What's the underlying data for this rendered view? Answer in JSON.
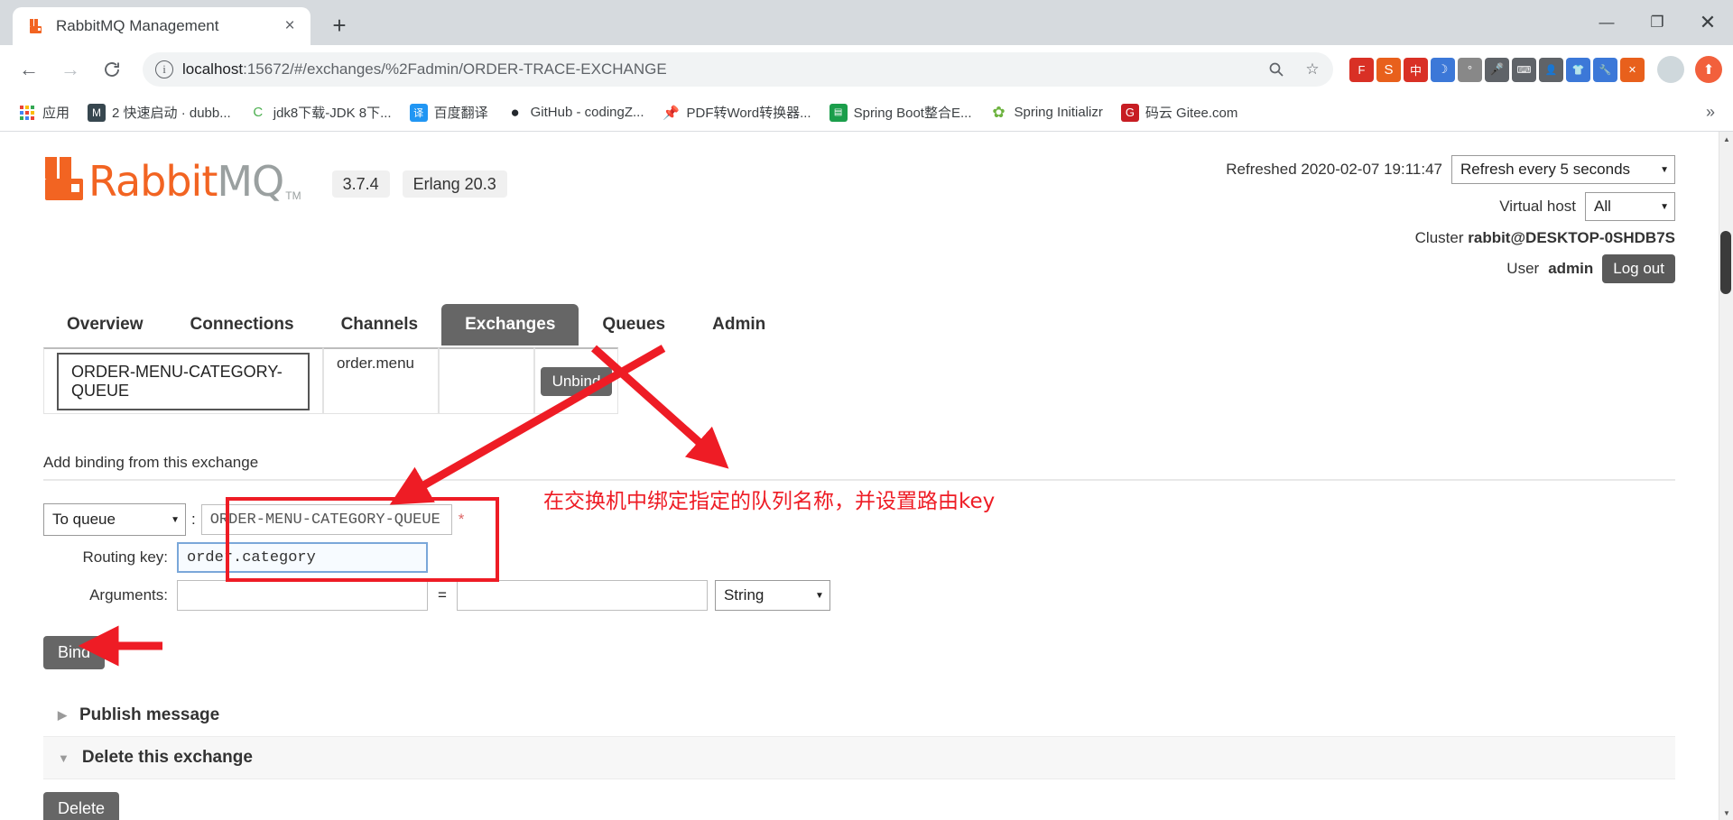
{
  "browser": {
    "tab": {
      "title": "RabbitMQ Management",
      "favicon": "rabbitmq-icon",
      "close": "×"
    },
    "newtab_label": "+",
    "window_controls": {
      "minimize": "—",
      "maximize": "❐",
      "close": "✕"
    },
    "nav": {
      "back": "←",
      "forward": "→",
      "reload": "C"
    },
    "omnibox": {
      "info_icon": "ⓘ",
      "url_host": "localhost",
      "url_path": ":15672/#/exchanges/%2Fadmin/ORDER-TRACE-EXCHANGE",
      "url_full": "localhost:15672/#/exchanges/%2Fadmin/ORDER-TRACE-EXCHANGE",
      "zoom_icon": "zoom-icon",
      "star_icon": "☆"
    },
    "extensions": [
      {
        "name": "translate-ext-icon",
        "glyph": "F",
        "color": "#d93025"
      },
      {
        "name": "sogou-ime-icon",
        "glyph": "S",
        "color": "#e8601c"
      },
      {
        "name": "ime-chinese-icon",
        "glyph": "中",
        "color": "#d93025"
      },
      {
        "name": "ime-moon-icon",
        "glyph": "☽",
        "color": "#3c78d8"
      },
      {
        "name": "ime-emoji-icon",
        "glyph": "°",
        "color": "#5f6368"
      },
      {
        "name": "ime-mic-icon",
        "glyph": "🎤",
        "color": "#5f6368"
      },
      {
        "name": "ime-keyboard-icon",
        "glyph": "⌨",
        "color": "#5f6368"
      },
      {
        "name": "ime-person-icon",
        "glyph": "👤",
        "color": "#5f6368"
      },
      {
        "name": "ime-shirt-icon",
        "glyph": "👕",
        "color": "#3c78d8"
      },
      {
        "name": "ime-wrench-icon",
        "glyph": "🔧",
        "color": "#3c78d8"
      },
      {
        "name": "ime-close-icon",
        "glyph": "✕",
        "color": "#e8601c"
      }
    ],
    "avatar": "profile-avatar",
    "menu": "chrome-menu-icon",
    "bookmarks": [
      {
        "label": "应用",
        "icon": "apps-grid-icon",
        "color": "#ffffff"
      },
      {
        "label": "2 快速启动 · dubb...",
        "icon": "notebook-icon",
        "color": "#37474f"
      },
      {
        "label": "jdk8下载-JDK 8下...",
        "icon": "csdn-icon",
        "color": "#4caf50"
      },
      {
        "label": "百度翻译",
        "icon": "translate-icon",
        "color": "#2196f3"
      },
      {
        "label": "GitHub - codingZ...",
        "icon": "github-icon",
        "color": "#24292e"
      },
      {
        "label": "PDF转Word转换器...",
        "icon": "pdf-icon",
        "color": "#e8601c"
      },
      {
        "label": "Spring Boot整合E...",
        "icon": "spring-doc-icon",
        "color": "#1b9e4b"
      },
      {
        "label": "Spring Initializr",
        "icon": "spring-icon",
        "color": "#6db33f"
      },
      {
        "label": "码云 Gitee.com",
        "icon": "gitee-icon",
        "color": "#c71d23"
      }
    ],
    "bookmarks_overflow": "»"
  },
  "app": {
    "logo": {
      "text_a": "Rabbit",
      "text_b": "MQ",
      "tm": "TM",
      "mark": "rabbitmq-logo-mark"
    },
    "version_badge": "3.7.4",
    "erlang_badge": "Erlang 20.3",
    "header": {
      "refreshed_text": "Refreshed 2020-02-07 19:11:47",
      "refresh_select": {
        "value": "Refresh every 5 seconds",
        "arrow": "▼"
      },
      "vhost_label": "Virtual host",
      "vhost_select": {
        "value": "All",
        "arrow": "▼"
      },
      "cluster_label": "Cluster",
      "cluster_value": "rabbit@DESKTOP-0SHDB7S",
      "user_label": "User",
      "user_value": "admin",
      "logout_label": "Log out"
    },
    "tabs": [
      {
        "label": "Overview",
        "active": false
      },
      {
        "label": "Connections",
        "active": false
      },
      {
        "label": "Channels",
        "active": false
      },
      {
        "label": "Exchanges",
        "active": true
      },
      {
        "label": "Queues",
        "active": false
      },
      {
        "label": "Admin",
        "active": false
      }
    ],
    "bindings_row": {
      "queue_name": "ORDER-MENU-CATEGORY-QUEUE",
      "routing_key": "order.menu",
      "arguments": "",
      "unbind_label": "Unbind"
    },
    "add_binding": {
      "section_title": "Add binding from this exchange",
      "target_select": {
        "value": "To queue",
        "arrow": "▼"
      },
      "colon": ":",
      "destination_value": "ORDER-MENU-CATEGORY-QUEUE",
      "destination_required_mark": "*",
      "routing_key_label": "Routing key:",
      "routing_key_value": "order.category",
      "arguments_label": "Arguments:",
      "argument_key_value": "",
      "equals": "=",
      "argument_value_value": "",
      "argument_type_select": {
        "value": "String",
        "arrow": "▼"
      },
      "bind_label": "Bind"
    },
    "publish_section": {
      "label": "Publish message",
      "caret": "▶"
    },
    "delete_section": {
      "label": "Delete this exchange",
      "caret": "▼",
      "delete_label": "Delete"
    }
  },
  "annotations": {
    "note_text": "在交换机中绑定指定的队列名称，并设置路由key",
    "highlight_color": "#ee1c25",
    "arrow_to_form": "red-arrow-pointing-to-binding-form",
    "arrow_to_unbind": "red-arrow-pointing-to-exchanges-tab",
    "arrow_to_bind": "red-arrow-pointing-to-bind-button"
  },
  "scrollbar": {
    "up": "▲",
    "down": "▼"
  }
}
